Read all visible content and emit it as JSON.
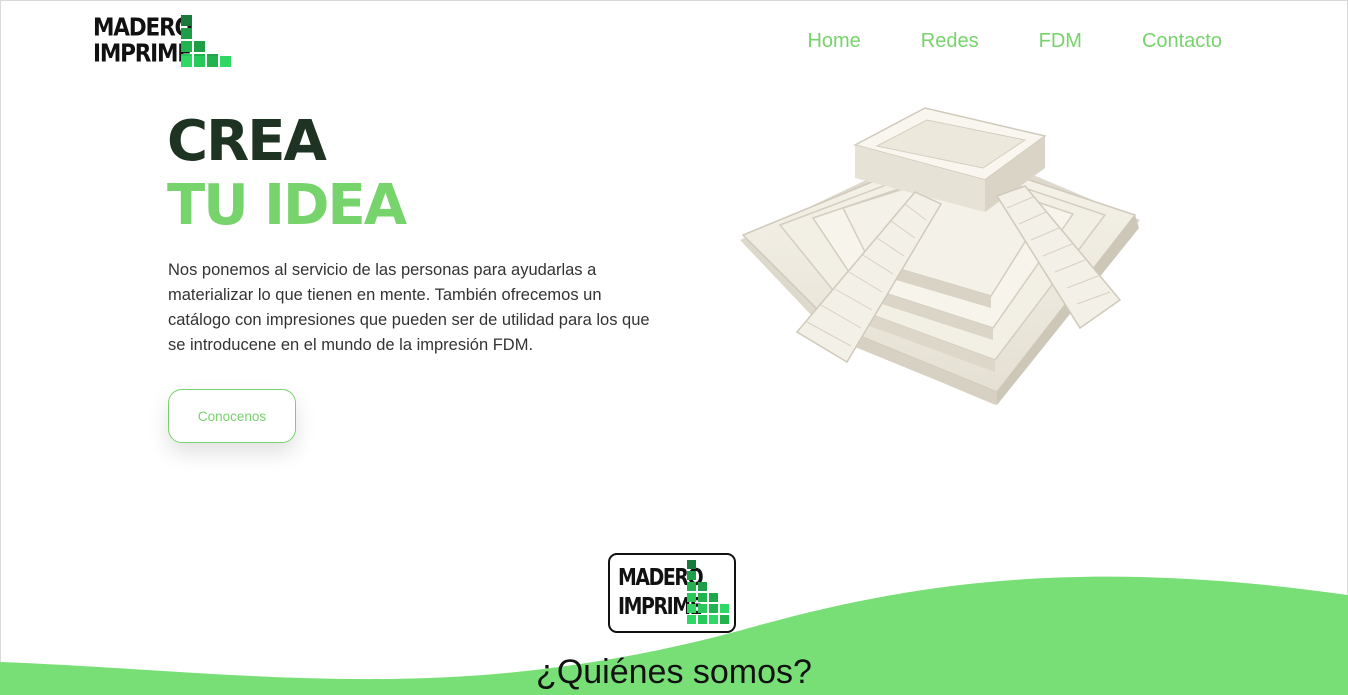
{
  "brand": {
    "logo_line1": "MADERO",
    "logo_line2": "IMPRIME",
    "color_primary": "#77d36b",
    "color_dark": "#1f3322"
  },
  "nav": {
    "items": [
      {
        "label": "Home"
      },
      {
        "label": "Redes"
      },
      {
        "label": "FDM"
      },
      {
        "label": "Contacto"
      }
    ]
  },
  "hero": {
    "title_line1": "CREA",
    "title_line2": "TU IDEA",
    "description": "Nos ponemos al servicio de las personas para ayudarlas a materializar lo que tienen en mente. También ofrecemos un catálogo con impresiones que pueden ser de utilidad para los que se introducene en el mundo de la impresión FDM.",
    "cta_label": "Conocenos",
    "image_icon": "stepped-pyramid-3d-print"
  },
  "about": {
    "title": "¿Quiénes somos?"
  }
}
